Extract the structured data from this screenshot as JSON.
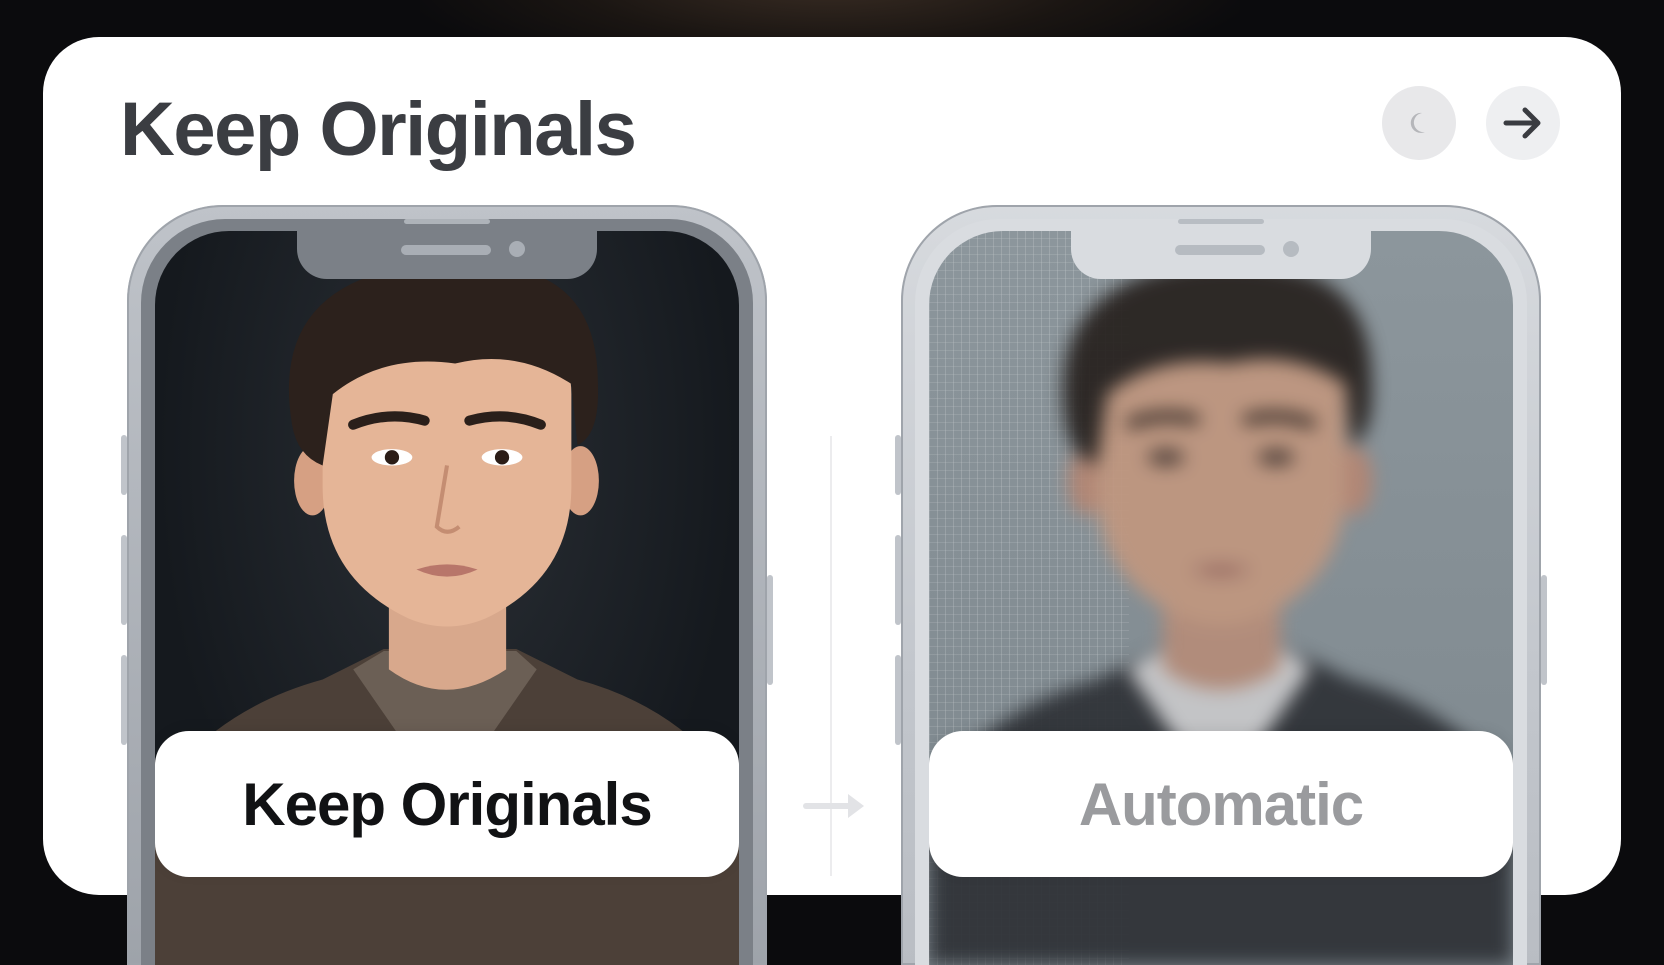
{
  "header": {
    "title": "Keep Originals"
  },
  "nav": {
    "prev_icon": "crescent-icon",
    "next_icon": "arrow-right-icon"
  },
  "comparison": {
    "left": {
      "label": "Keep Originals",
      "image": "sharp portrait photo"
    },
    "right": {
      "label": "Automatic",
      "image": "compressed pixelated portrait photo"
    }
  },
  "colors": {
    "title": "#3b3d42",
    "label_active": "#111214",
    "label_inactive": "#9a9b9e",
    "card": "#ffffff"
  }
}
